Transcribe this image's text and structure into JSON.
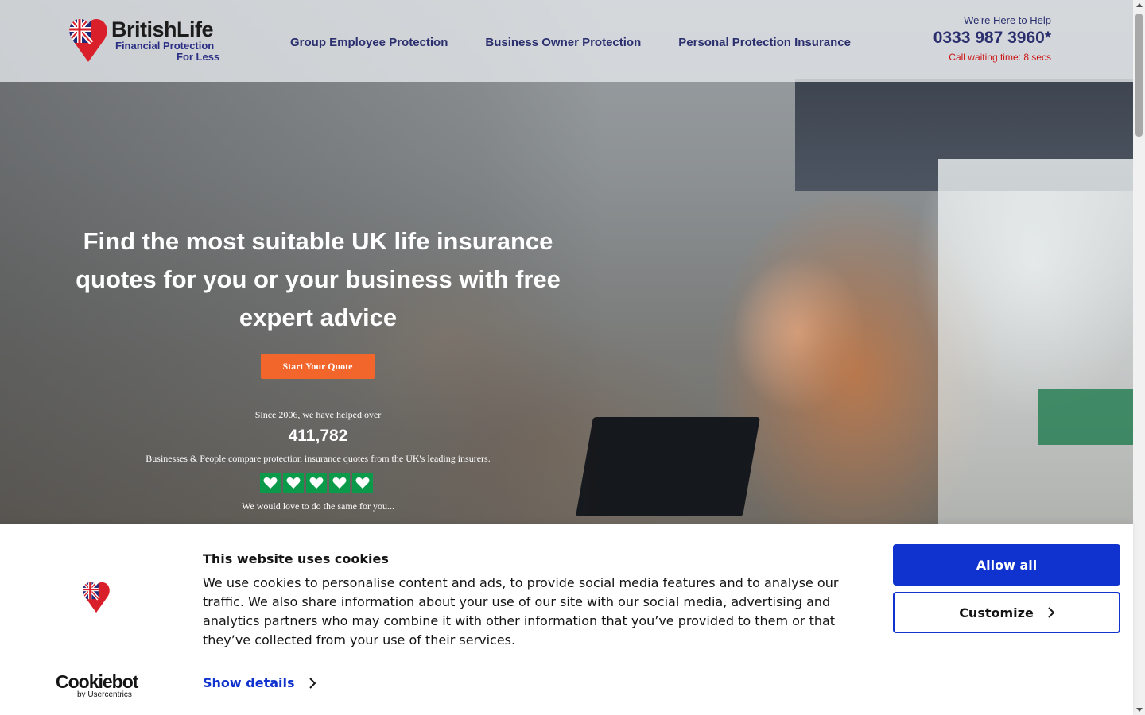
{
  "header": {
    "logo": {
      "name": "BritishLife",
      "tagline_line1": "Financial Protection",
      "tagline_line2": "For Less",
      "icon": "union-jack-heart-pin-icon"
    },
    "nav": [
      {
        "label": "Group Employee Protection"
      },
      {
        "label": "Business Owner Protection"
      },
      {
        "label": "Personal Protection Insurance"
      }
    ],
    "contact": {
      "help": "We're Here to Help",
      "phone": "0333 987 3960*",
      "wait": "Call waiting time: 8 secs"
    }
  },
  "hero": {
    "title": "Find the most suitable UK life insurance quotes for you or your business with free expert advice",
    "cta_label": "Start  Your Quote",
    "since_text": "Since 2006, we have helped over",
    "count": "411,782",
    "compare_text": "Businesses & People compare protection insurance quotes from the UK's leading insurers.",
    "rating": {
      "value": 5,
      "max": 5,
      "icon": "heart-icon"
    },
    "love_text": "We would love to do the same for you..."
  },
  "cookie_banner": {
    "title": "This website uses cookies",
    "text": "We use cookies to personalise content and ads, to provide social media features and to analyse our traffic. We also share information about your use of our site with our social media, advertising and analytics partners who may combine it with other information that you’ve provided to them or that they’ve collected from your use of their services.",
    "show_details": "Show details",
    "allow_all": "Allow all",
    "customize": "Customize",
    "provider_name": "Cookiebot",
    "provider_sub": "by Usercentrics"
  },
  "colors": {
    "brand_navy": "#2b2f6e",
    "cta_orange": "#f2652b",
    "wait_red": "#cc1414",
    "rating_green": "#0a9a4a",
    "cookie_blue": "#1032cf"
  }
}
